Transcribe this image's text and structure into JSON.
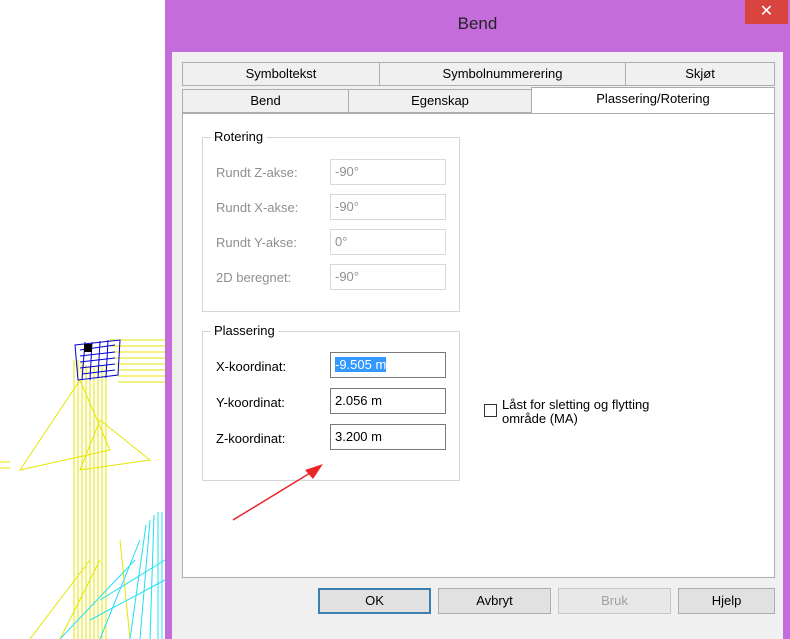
{
  "window": {
    "title": "Bend",
    "close_symbol": "✕"
  },
  "tabs": {
    "row1": [
      "Symboltekst",
      "Symbolnummerering",
      "Skjøt"
    ],
    "row2": [
      "Bend",
      "Egenskap",
      "Plassering/Rotering"
    ],
    "active": "Plassering/Rotering"
  },
  "rotering": {
    "title": "Rotering",
    "fields": [
      {
        "label": "Rundt Z-akse:",
        "value": "-90°"
      },
      {
        "label": "Rundt X-akse:",
        "value": "-90°"
      },
      {
        "label": "Rundt Y-akse:",
        "value": "0°"
      },
      {
        "label": "2D beregnet:",
        "value": "-90°"
      }
    ]
  },
  "plassering": {
    "title": "Plassering",
    "fields": [
      {
        "label": "X-koordinat:",
        "value": "-9.505 m"
      },
      {
        "label": "Y-koordinat:",
        "value": "2.056 m"
      },
      {
        "label": "Z-koordinat:",
        "value": "3.200 m"
      }
    ]
  },
  "checkbox": {
    "label_line1": "Låst for sletting og flytting",
    "label_line2": "område (MA)",
    "checked": false
  },
  "buttons": {
    "ok": "OK",
    "cancel": "Avbryt",
    "apply": "Bruk",
    "help": "Hjelp"
  },
  "colors": {
    "title_bar": "#c46cdc",
    "close_button": "#d9443e",
    "selection": "#3399ff",
    "annotation_arrow": "#e8262a"
  }
}
